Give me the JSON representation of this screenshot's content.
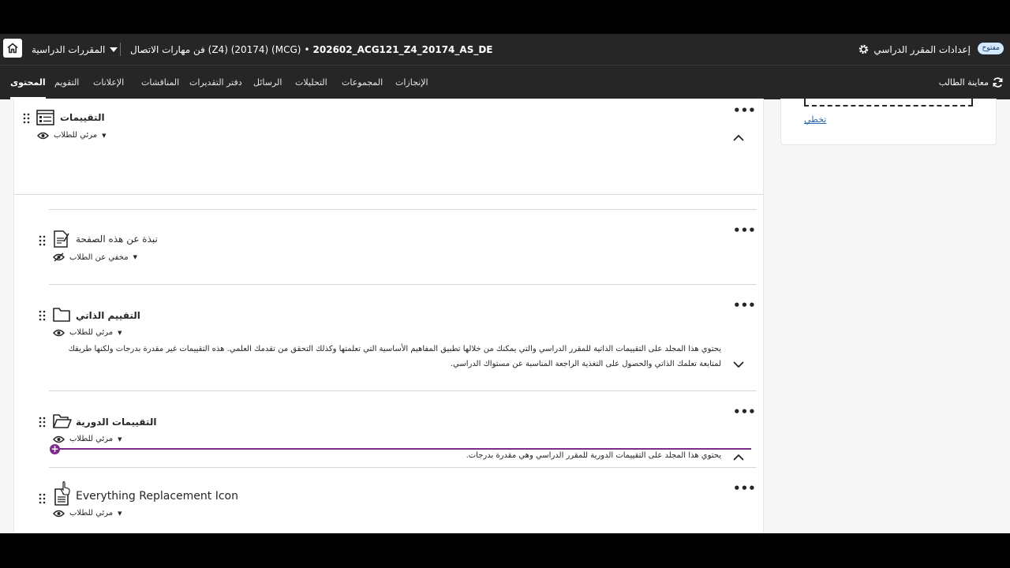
{
  "topbar": {
    "courses_label": "المقررات الدراسية",
    "course_code": "202602_ACG121_Z4_20174_AS_DE",
    "course_name": "فن مهارات الاتصال (Z4) (20174) (MCG)",
    "separator": "•",
    "settings_label": "إعدادات المقرر الدراسي",
    "status_badge": "مفتوح"
  },
  "nav": {
    "tabs": [
      {
        "label": "المحتوى",
        "active": true
      },
      {
        "label": "التقويم"
      },
      {
        "label": "الإعلانات"
      },
      {
        "label": "المناقشات"
      },
      {
        "label": "دفتر التقديرات"
      },
      {
        "label": "الرسائل"
      },
      {
        "label": "التحليلات"
      },
      {
        "label": "المجموعات"
      },
      {
        "label": "الإنجازات"
      }
    ],
    "student_preview": "معاينة الطالب"
  },
  "sidebar": {
    "skip_link": "تخطي"
  },
  "content": {
    "folder": {
      "title": "التقييمات",
      "visibility": "مرئي للطلاب"
    },
    "items": [
      {
        "title": "نبذة عن هذه الصفحة",
        "visibility": "مخفي عن الطلاب",
        "icon": "document-edit-icon"
      },
      {
        "title": "التقييم الذاتي",
        "visibility": "مرئي للطلاب",
        "icon": "folder-icon",
        "description": "يحتوي هذا المجلد على التقييمات الذاتية للمقرر الدراسي والتي يمكنك من خلالها تطبيق المفاهيم الأساسية التي تعلمتها وكذلك التحقق من تقدمك العلمي. هذه التقييمات غير مقدرة بدرجات ولكنها طريقك لمتابعة تعلمك الذاتي والحصول على التغذية الراجعة المناسبة عن مستواك الدراسي."
      },
      {
        "title": "التقييمات الدورية",
        "visibility": "مرئي للطلاب",
        "icon": "folder-open-icon",
        "description": "يحتوي هذا المجلد على التقييمات الدورية للمقرر الدراسي وهي مقدرة بدرجات."
      },
      {
        "title": "Everything Replacement Icon",
        "visibility": "مرئي للطلاب",
        "icon": "document-icon"
      }
    ],
    "more_glyph": "•••",
    "add_glyph": "+"
  },
  "help": {
    "glyph": "?"
  },
  "colors": {
    "bar": "#262626",
    "accent": "#7c2b8c",
    "link": "#2a6aaa"
  }
}
